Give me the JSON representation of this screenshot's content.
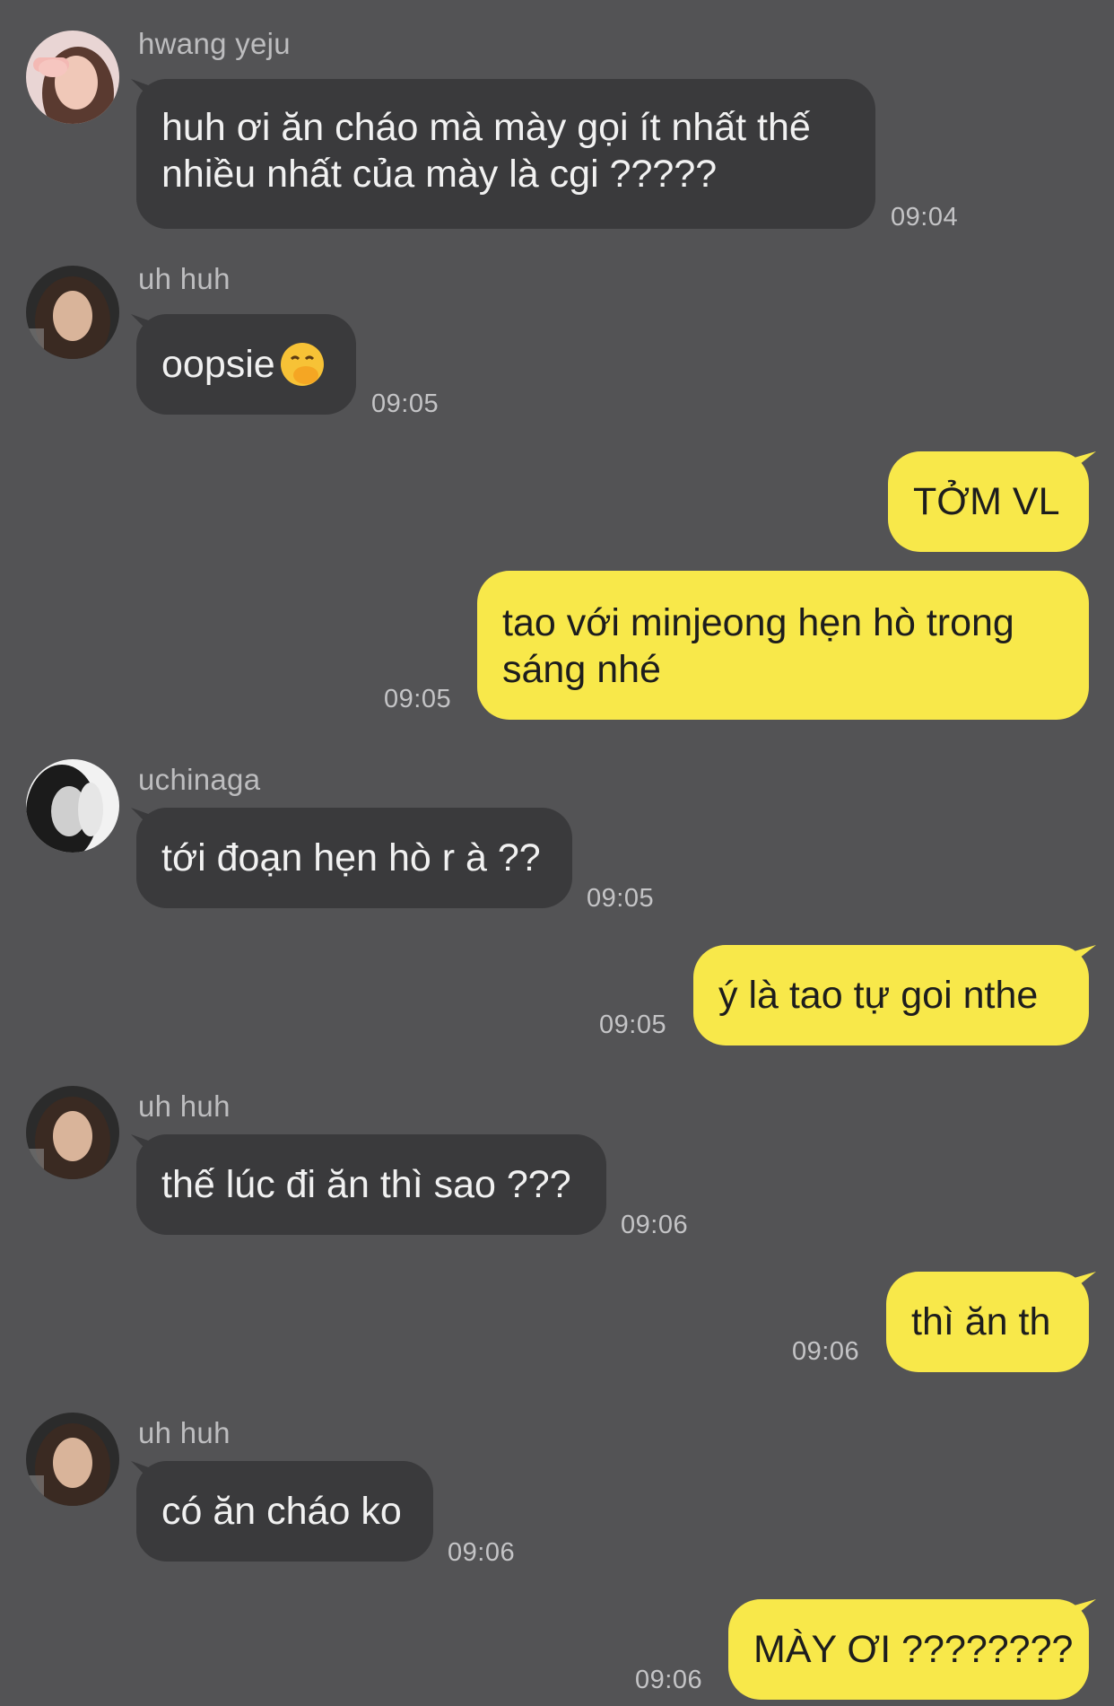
{
  "colors": {
    "background": "#535355",
    "incoming_bubble": "#3a3a3c",
    "outgoing_bubble": "#f8e84a"
  },
  "messages": [
    {
      "sender": "hwang yeju",
      "text": "huh ơi ăn cháo mà mày gọi ít nhất thế",
      "text2": "nhiều nhất của mày là cgi  ?????",
      "time": "09:04"
    },
    {
      "sender": "uh huh",
      "text": "oopsie",
      "emoji": "hand-over-mouth-emoji",
      "time": "09:05"
    },
    {
      "text": "TỞM VL"
    },
    {
      "text": "tao với minjeong hẹn hò trong",
      "text2": "sáng nhé",
      "time": "09:05"
    },
    {
      "sender": "uchinaga",
      "text": "tới đoạn hẹn hò r à ??",
      "time": "09:05"
    },
    {
      "text": "ý là tao tự goi nthe",
      "time": "09:05"
    },
    {
      "sender": "uh huh",
      "text": "thế lúc đi ăn thì sao ???",
      "time": "09:06"
    },
    {
      "text": "thì ăn th",
      "time": "09:06"
    },
    {
      "sender": "uh huh",
      "text": "có ăn cháo ko",
      "time": "09:06"
    },
    {
      "text": "MÀY ƠI ????????",
      "time": "09:06"
    }
  ]
}
